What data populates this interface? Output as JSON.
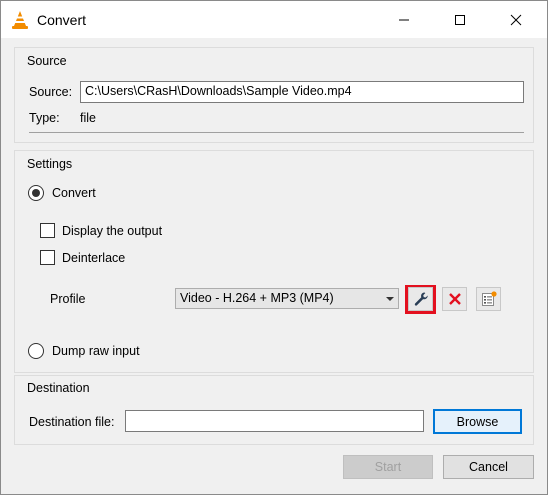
{
  "window": {
    "title": "Convert"
  },
  "source_group": {
    "title": "Source",
    "source_label": "Source:",
    "source_value": "C:\\Users\\CRasH\\Downloads\\Sample Video.mp4",
    "type_label": "Type:",
    "type_value": "file"
  },
  "settings_group": {
    "title": "Settings",
    "convert_label": "Convert",
    "convert_selected": true,
    "display_output_label": "Display the output",
    "display_output_checked": false,
    "deinterlace_label": "Deinterlace",
    "deinterlace_checked": false,
    "profile_label": "Profile",
    "profile_selected": "Video - H.264 + MP3 (MP4)",
    "dump_raw_label": "Dump raw input",
    "dump_raw_selected": false
  },
  "destination_group": {
    "title": "Destination",
    "dest_label": "Destination file:",
    "dest_value": "",
    "browse_label": "Browse"
  },
  "footer": {
    "start_label": "Start",
    "cancel_label": "Cancel"
  },
  "icons": {
    "app": "vlc-cone-icon",
    "edit_profile": "wrench-icon",
    "delete_profile": "red-x-icon",
    "new_profile": "list-new-icon"
  },
  "colors": {
    "highlight": "#e3101f",
    "focus": "#0078d7",
    "vlc_orange": "#f28c00"
  }
}
